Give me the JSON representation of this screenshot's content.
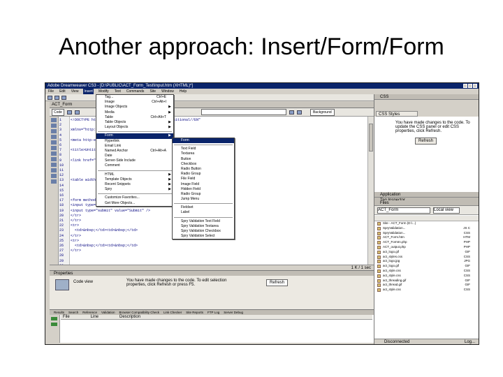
{
  "slide": {
    "title": "Another approach: Insert/Form/Form"
  },
  "window": {
    "title": "Adobe Dreamweaver CS3 - [D:\\PUBLIC\\ACT_Form_Test\\Input.htm (XHTML)*]"
  },
  "menubar": [
    "File",
    "Edit",
    "View",
    "Insert",
    "Modify",
    "Text",
    "Commands",
    "Site",
    "Window",
    "Help"
  ],
  "insert_menu": {
    "rows": [
      {
        "label": "Tag...",
        "shortcut": "Ctrl+E",
        "arrow": ""
      },
      {
        "label": "Image",
        "shortcut": "Ctrl+Alt+I",
        "arrow": ""
      },
      {
        "label": "Image Objects",
        "shortcut": "",
        "arrow": "▶"
      },
      {
        "label": "Media",
        "shortcut": "",
        "arrow": "▶"
      },
      {
        "label": "Table",
        "shortcut": "Ctrl+Alt+T",
        "arrow": ""
      },
      {
        "label": "Table Objects",
        "shortcut": "",
        "arrow": "▶"
      },
      {
        "label": "Layout Objects",
        "shortcut": "",
        "arrow": "▶"
      },
      {
        "label": "Form",
        "shortcut": "",
        "arrow": "▶",
        "hl": true
      },
      {
        "label": "Hyperlink",
        "shortcut": "",
        "arrow": ""
      },
      {
        "label": "Email Link",
        "shortcut": "",
        "arrow": ""
      },
      {
        "label": "Named Anchor",
        "shortcut": "Ctrl+Alt+A",
        "arrow": ""
      },
      {
        "label": "Date",
        "shortcut": "",
        "arrow": ""
      },
      {
        "label": "Server-Side Include",
        "shortcut": "",
        "arrow": ""
      },
      {
        "label": "Comment",
        "shortcut": "",
        "arrow": ""
      },
      {
        "label": "HTML",
        "shortcut": "",
        "arrow": "▶"
      },
      {
        "label": "Template Objects",
        "shortcut": "",
        "arrow": "▶"
      },
      {
        "label": "Recent Snippets",
        "shortcut": "",
        "arrow": "▶"
      },
      {
        "label": "Spry",
        "shortcut": "",
        "arrow": "▶"
      },
      {
        "label": "Customize Favorites...",
        "shortcut": "",
        "arrow": ""
      },
      {
        "label": "Get More Objects...",
        "shortcut": "",
        "arrow": ""
      }
    ]
  },
  "form_menu": {
    "rows": [
      {
        "label": "Form",
        "hl": true
      },
      {
        "label": "Text Field"
      },
      {
        "label": "Textarea"
      },
      {
        "label": "Button"
      },
      {
        "label": "Checkbox"
      },
      {
        "label": "Radio Button"
      },
      {
        "label": "Radio Group"
      },
      {
        "label": "File Field"
      },
      {
        "label": "Image Field"
      },
      {
        "label": "Hidden Field"
      },
      {
        "label": "Radio Group"
      },
      {
        "label": "Jump Menu"
      },
      {
        "label": "Fieldset"
      },
      {
        "label": "Label"
      },
      {
        "label": "Spry Validation Text Field"
      },
      {
        "label": "Spry Validation Textarea"
      },
      {
        "label": "Spry Validation Checkbox"
      },
      {
        "label": "Spry Validation Select"
      }
    ]
  },
  "document": {
    "tab": "ACT_Form",
    "code_button": "Code",
    "back_button": "Background",
    "line_numbers": [
      "1",
      "2",
      "3",
      "4",
      "5",
      "6",
      "7",
      "8",
      "9",
      "10",
      "11",
      "12",
      "13",
      "14",
      "15",
      "16",
      "17",
      "18",
      "19",
      "20",
      "21",
      "22",
      "23",
      "24",
      "25",
      "26",
      "27",
      "28",
      "29",
      "30"
    ],
    "code_lines": [
      "<!DOCTYPE html PUBLIC \"-//W3C//DTD XHTML 1.0 Transitional//EN\"",
      "",
      "xmlns=\"http://www.w3.org/1999/xhtml\">",
      "",
      "<meta http-equiv=\"Content-Type\" content=\"text/html; charset=iso-8859-1\" />",
      "",
      "<title>Untitled Document</title>",
      "",
      "<link href=\"styles.css\" rel=\"stylesheet\" type=\"text/css\" />",
      "",
      "",
      "",
      "<table width=\"500\" cellpadding=\"5\" cellspacing=\"5\" border=",
      "",
      "",
      "",
      "<form method=\"post\" action=\"input.php\">",
      "<input type=\"text\" name=\"name\" size=\"40\" />",
      "<input type=\"submit\" value=\"Submit\" />",
      "</tr>",
      "</tr>",
      "<tr>",
      "  <td>&nbsp;</td><td>&nbsp;</td>",
      "</tr>",
      "<tr>",
      "  <td>&nbsp;</td><td>&nbsp;</td>",
      "</tr>",
      "",
      "",
      ""
    ],
    "status": "1 K / 1 sec"
  },
  "properties": {
    "header": "Properties",
    "label": "Code view",
    "message": "You have made changes to the code. To edit selection properties, click Refresh or press F5.",
    "refresh": "Refresh"
  },
  "results": {
    "tabs": [
      "Results",
      "Search",
      "Reference",
      "Validation",
      "Browser Compatibility Check",
      "Link Checker",
      "Site Reports",
      "FTP Log",
      "Server Debug"
    ],
    "columns": [
      "File",
      "Line",
      "Description"
    ]
  },
  "right_panel": {
    "css_header": "CSS",
    "css_tab": "CSS Styles",
    "css_message": "You have made changes to the code. To update the CSS panel or edit CSS properties, click Refresh.",
    "css_refresh": "Refresh",
    "app_header": "Application",
    "tag_header": "Tag Inspector",
    "files_header": "Files",
    "site": "ACT_Form",
    "view": "Local view",
    "files": [
      {
        "name": "Site - ACT_Form (D:\\...)",
        "size": ""
      },
      {
        "name": "SpryValidation...",
        "size": "JS C"
      },
      {
        "name": "SpryValidation...",
        "size": "CSS"
      },
      {
        "name": "ACT_Form.htm",
        "size": "HTM"
      },
      {
        "name": "ACT_FormIn.php",
        "size": "PHP"
      },
      {
        "name": "ACT_output.php",
        "size": "PHP"
      },
      {
        "name": "act_logo.gif",
        "size": "GIF"
      },
      {
        "name": "act_styles.css",
        "size": "CSS"
      },
      {
        "name": "act_logo.jpg",
        "size": "JPG"
      },
      {
        "name": "act_logo.gif",
        "size": "GIF"
      },
      {
        "name": "act_style.css",
        "size": "CSS"
      },
      {
        "name": "act_style.css",
        "size": "CSS"
      },
      {
        "name": "act_threading.gif",
        "size": "GIF"
      },
      {
        "name": "act_thread.gif",
        "size": "GIF"
      },
      {
        "name": "act_style.css",
        "size": "CSS"
      }
    ],
    "file_status": "Disconnected",
    "log": "Log..."
  }
}
